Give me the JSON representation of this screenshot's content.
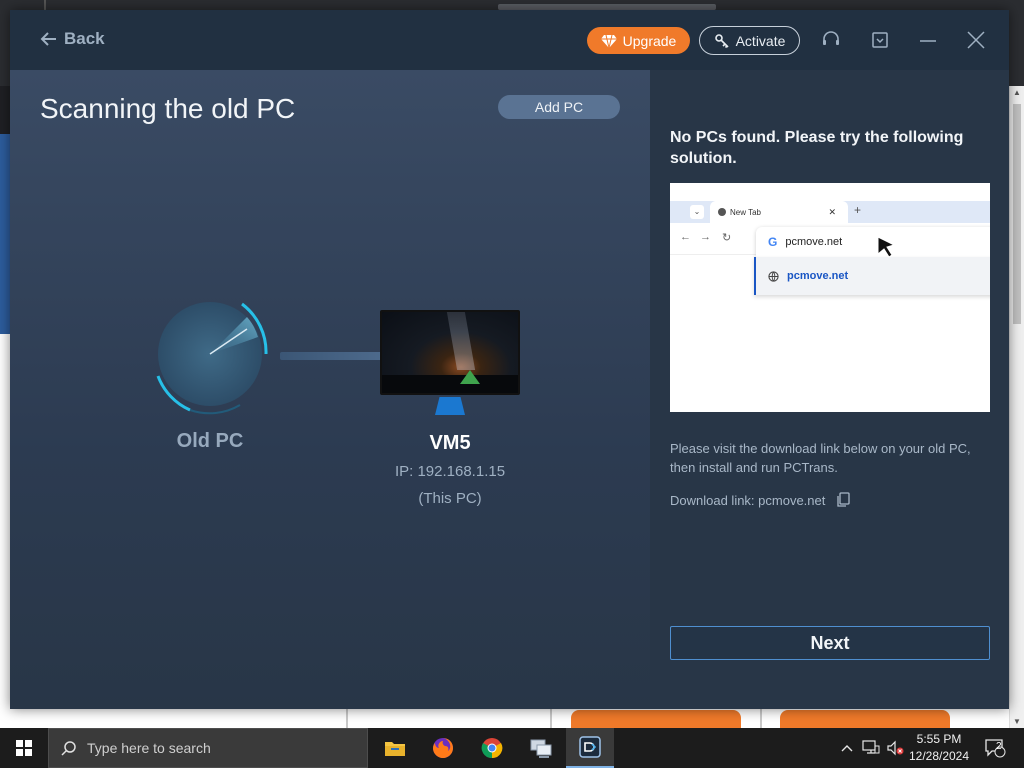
{
  "titlebar": {
    "back_label": "Back",
    "upgrade_label": "Upgrade",
    "activate_label": "Activate"
  },
  "main": {
    "title": "Scanning the old PC",
    "add_pc_label": "Add PC",
    "old_pc_label": "Old PC",
    "this_pc": {
      "name": "VM5",
      "ip": "IP: 192.168.1.15",
      "note": "(This PC)"
    }
  },
  "side": {
    "heading": "No PCs found. Please try the following solution.",
    "illustration": {
      "tab_label": "New Tab",
      "omnibox_text": "pcmove.net",
      "suggestion_text": "pcmove.net"
    },
    "instructions": "Please visit the download link below on your old PC, then install and run PCTrans.",
    "download_link": "Download link: pcmove.net",
    "next_label": "Next"
  },
  "taskbar": {
    "search_placeholder": "Type here to search",
    "time": "5:55 PM",
    "date": "12/28/2024",
    "notification_count": "2",
    "apps": [
      "file-explorer",
      "firefox",
      "chrome",
      "network-tool",
      "pctrans"
    ]
  },
  "colors": {
    "accent_orange": "#f07a2a",
    "panel_dark": "#283647",
    "next_border": "#4f8fd0",
    "radar_cyan": "#27c0e8"
  }
}
